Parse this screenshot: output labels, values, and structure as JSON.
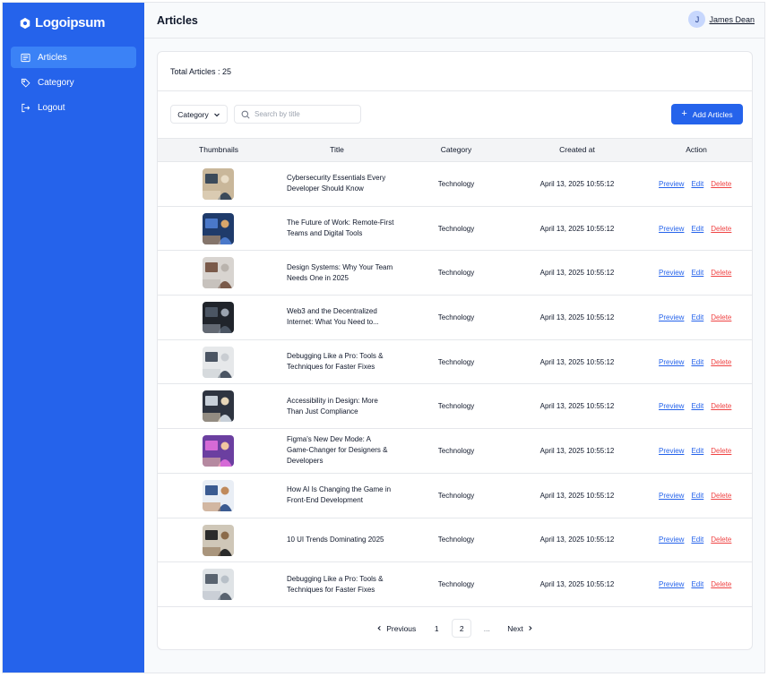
{
  "brand": {
    "name": "Logoipsum"
  },
  "sidebar": {
    "items": [
      {
        "label": "Articles",
        "icon": "newspaper-icon",
        "active": true
      },
      {
        "label": "Category",
        "icon": "tag-icon",
        "active": false
      },
      {
        "label": "Logout",
        "icon": "logout-icon",
        "active": false
      }
    ]
  },
  "header": {
    "title": "Articles",
    "user": {
      "initial": "J",
      "name": "James Dean"
    }
  },
  "summary": {
    "total_label": "Total Articles : 25"
  },
  "filters": {
    "category_label": "Category",
    "search_placeholder": "Search by title",
    "add_label": "Add Articles"
  },
  "table": {
    "columns": [
      "Thumbnails",
      "Title",
      "Category",
      "Created at",
      "Action"
    ],
    "rows": [
      {
        "title": "Cybersecurity Essentials Every Developer Should Know",
        "category": "Technology",
        "created": "April 13, 2025 10:55:12"
      },
      {
        "title": "The Future of Work: Remote-First Teams and Digital Tools",
        "category": "Technology",
        "created": "April 13, 2025 10:55:12"
      },
      {
        "title": "Design Systems: Why Your Team Needs One in 2025",
        "category": "Technology",
        "created": "April 13, 2025 10:55:12"
      },
      {
        "title": "Web3 and the Decentralized Internet: What You Need to...",
        "category": "Technology",
        "created": "April 13, 2025 10:55:12"
      },
      {
        "title": "Debugging Like a Pro: Tools & Techniques for Faster Fixes",
        "category": "Technology",
        "created": "April 13, 2025 10:55:12"
      },
      {
        "title": "Accessibility in Design: More Than Just Compliance",
        "category": "Technology",
        "created": "April 13, 2025 10:55:12"
      },
      {
        "title": "Figma's New Dev Mode: A Game-Changer for Designers & Developers",
        "category": "Technology",
        "created": "April 13, 2025 10:55:12"
      },
      {
        "title": "How AI Is Changing the Game in Front-End Development",
        "category": "Technology",
        "created": "April 13, 2025 10:55:12"
      },
      {
        "title": "10 UI Trends Dominating 2025",
        "category": "Technology",
        "created": "April 13, 2025 10:55:12"
      },
      {
        "title": "Debugging Like a Pro: Tools & Techniques for Faster Fixes",
        "category": "Technology",
        "created": "April 13, 2025 10:55:12"
      }
    ],
    "actions": {
      "preview": "Preview",
      "edit": "Edit",
      "delete": "Delete"
    }
  },
  "pagination": {
    "previous": "Previous",
    "pages": [
      "1",
      "2"
    ],
    "current": "2",
    "ellipsis": "...",
    "next": "Next"
  },
  "colors": {
    "primary": "#2563eb",
    "active_nav": "#3b82f6",
    "danger": "#ef4444",
    "page_bg": "#f8fafc",
    "border": "#e5e7eb"
  }
}
